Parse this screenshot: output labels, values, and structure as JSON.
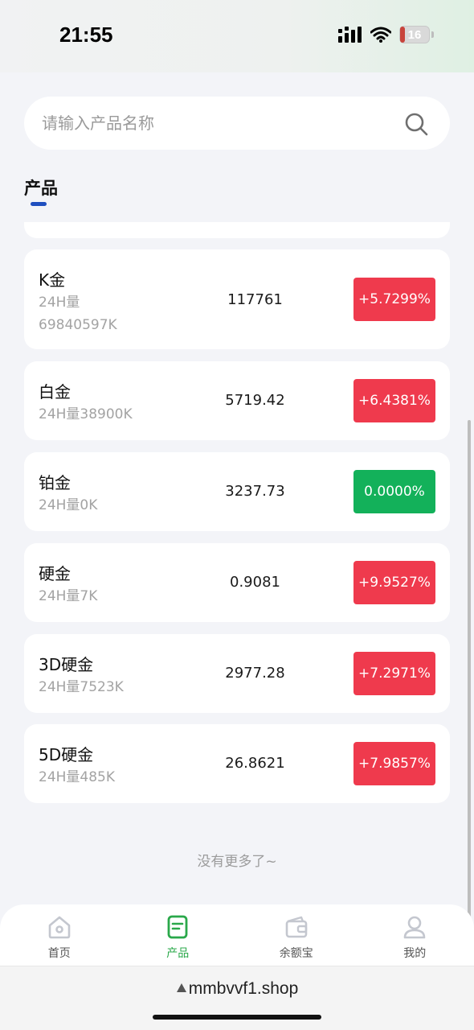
{
  "status": {
    "time": "21:55",
    "battery": "16",
    "battery_level": 0.16
  },
  "search": {
    "placeholder": "请输入产品名称"
  },
  "section": {
    "title": "产品"
  },
  "products": [
    {
      "name": "K金",
      "volume": "24H量\n69840597K",
      "price": "117761",
      "change": "+5.7299%",
      "trend": "up"
    },
    {
      "name": "白金",
      "volume": "24H量38900K",
      "price": "5719.42",
      "change": "+6.4381%",
      "trend": "up"
    },
    {
      "name": "铂金",
      "volume": "24H量0K",
      "price": "3237.73",
      "change": "0.0000%",
      "trend": "flat"
    },
    {
      "name": "硬金",
      "volume": "24H量7K",
      "price": "0.9081",
      "change": "+9.9527%",
      "trend": "up"
    },
    {
      "name": "3D硬金",
      "volume": "24H量7523K",
      "price": "2977.28",
      "change": "+7.2971%",
      "trend": "up"
    },
    {
      "name": "5D硬金",
      "volume": "24H量485K",
      "price": "26.8621",
      "change": "+7.9857%",
      "trend": "up"
    }
  ],
  "list_footer": "没有更多了~",
  "tabs": [
    {
      "label": "首页",
      "icon": "home-icon"
    },
    {
      "label": "产品",
      "icon": "document-icon",
      "active": true
    },
    {
      "label": "余额宝",
      "icon": "wallet-icon"
    },
    {
      "label": "我的",
      "icon": "profile-icon"
    }
  ],
  "browser": {
    "url": "mmbvvf1.shop"
  },
  "colors": {
    "up": "#ef3a4d",
    "flat": "#13b15a",
    "active_tab": "#2aa84a",
    "accent": "#1f4fbf"
  }
}
